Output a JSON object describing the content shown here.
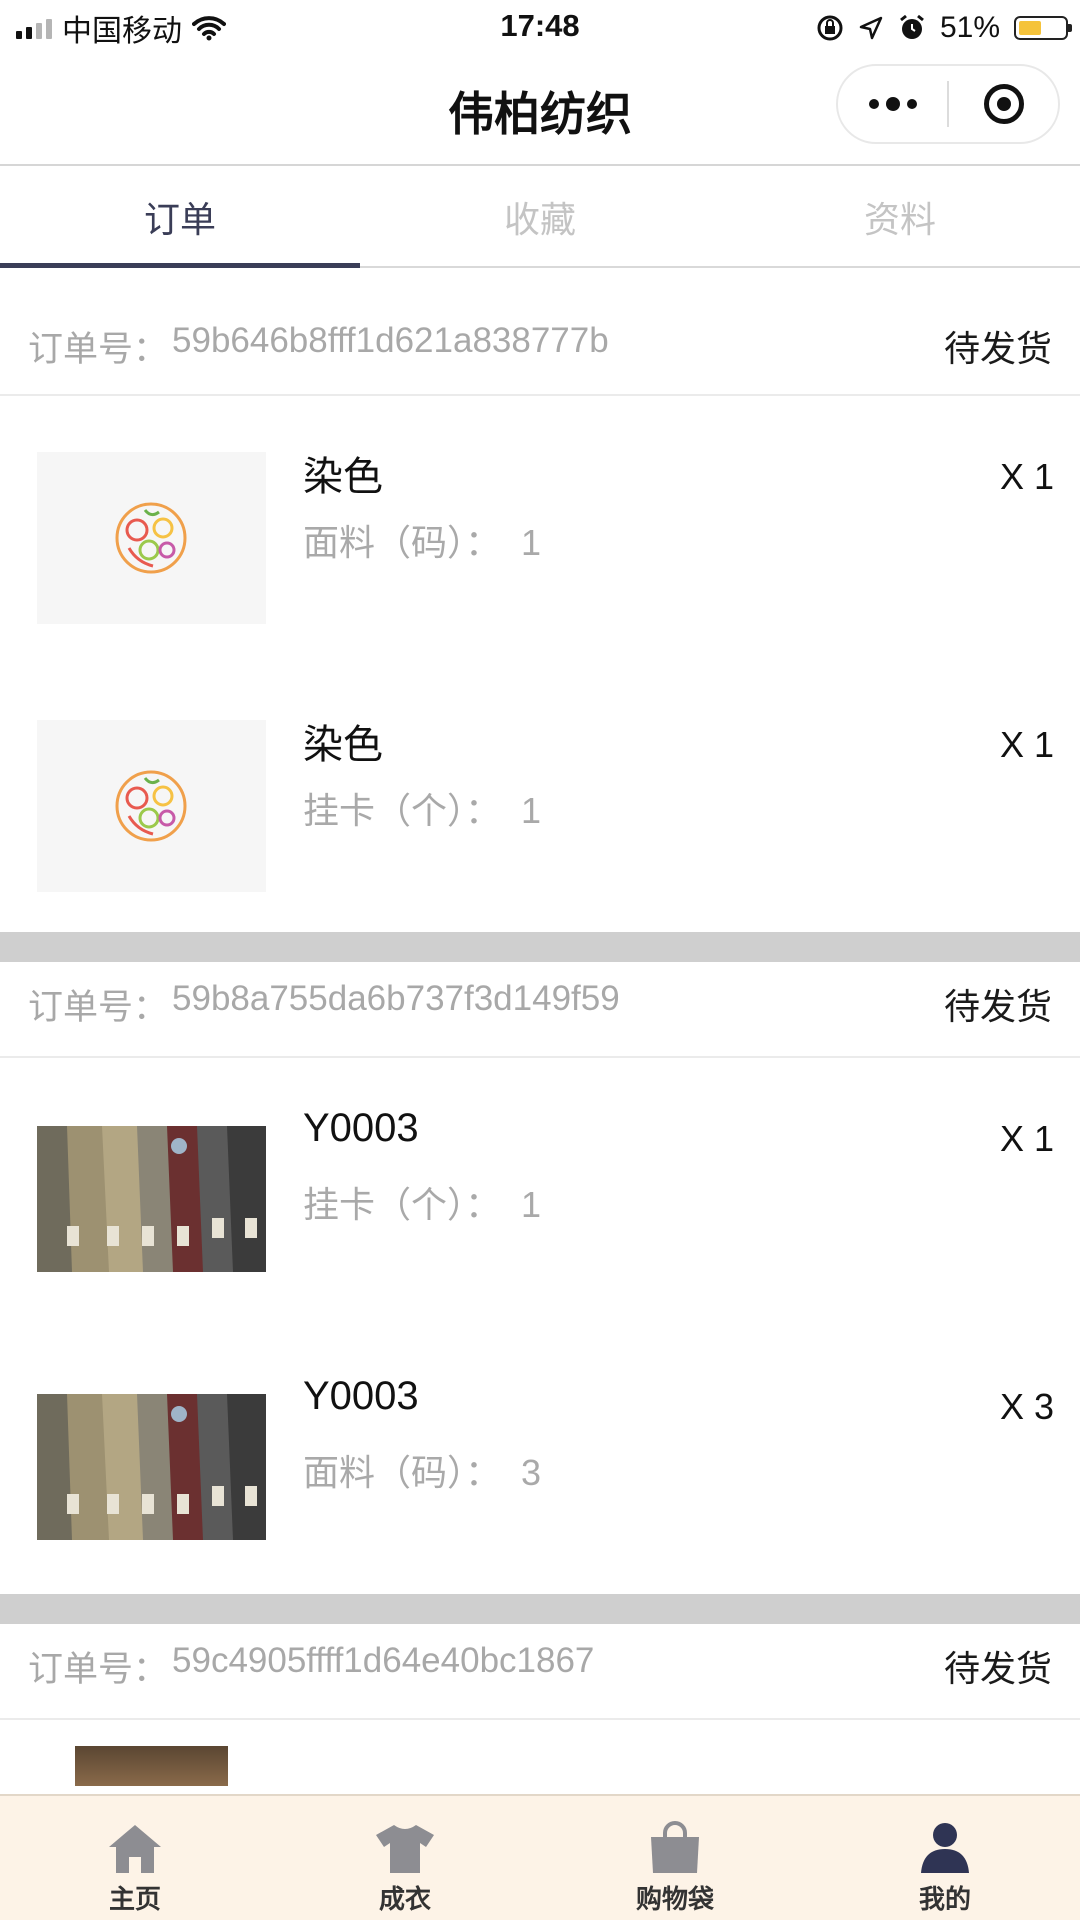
{
  "status_bar": {
    "carrier": "中国移动",
    "time": "17:48",
    "battery": "51%",
    "battery_level": 0.51
  },
  "nav": {
    "title": "伟柏纺织",
    "more_icon": "more-dots-icon",
    "close_icon": "target-icon"
  },
  "tabs": [
    {
      "label": "订单",
      "active": true
    },
    {
      "label": "收藏",
      "active": false
    },
    {
      "label": "资料",
      "active": false
    }
  ],
  "order_prefix": "订单号：",
  "orders": [
    {
      "order_no": "59b646b8fff1d621a838777b",
      "status": "待发货",
      "items": [
        {
          "name": "染色",
          "spec": "面料（码）：  1",
          "qty": "X 1",
          "image": "fruit-logo-icon"
        },
        {
          "name": "染色",
          "spec": "挂卡（个）：  1",
          "qty": "X 1",
          "image": "fruit-logo-icon"
        }
      ]
    },
    {
      "order_no": "59b8a755da6b737f3d149f59",
      "status": "待发货",
      "items": [
        {
          "name": "Y0003",
          "spec": "挂卡（个）：  1",
          "qty": "X 1",
          "image": "jackets-photo"
        },
        {
          "name": "Y0003",
          "spec": "面料（码）：  3",
          "qty": "X 3",
          "image": "jackets-photo"
        }
      ]
    },
    {
      "order_no": "59c4905ffff1d64e40bc1867",
      "status": "待发货",
      "items": []
    }
  ],
  "tabbar": [
    {
      "label": "主页",
      "icon": "home-icon"
    },
    {
      "label": "成衣",
      "icon": "tshirt-icon"
    },
    {
      "label": "购物袋",
      "icon": "shopping-bag-icon"
    },
    {
      "label": "我的",
      "icon": "user-icon",
      "active": true
    }
  ],
  "colors": {
    "accent": "#3a3d57",
    "tabbar_bg": "#fdf3e7",
    "inactive_icon": "#8d8d92",
    "separator": "#cfcfcf"
  }
}
